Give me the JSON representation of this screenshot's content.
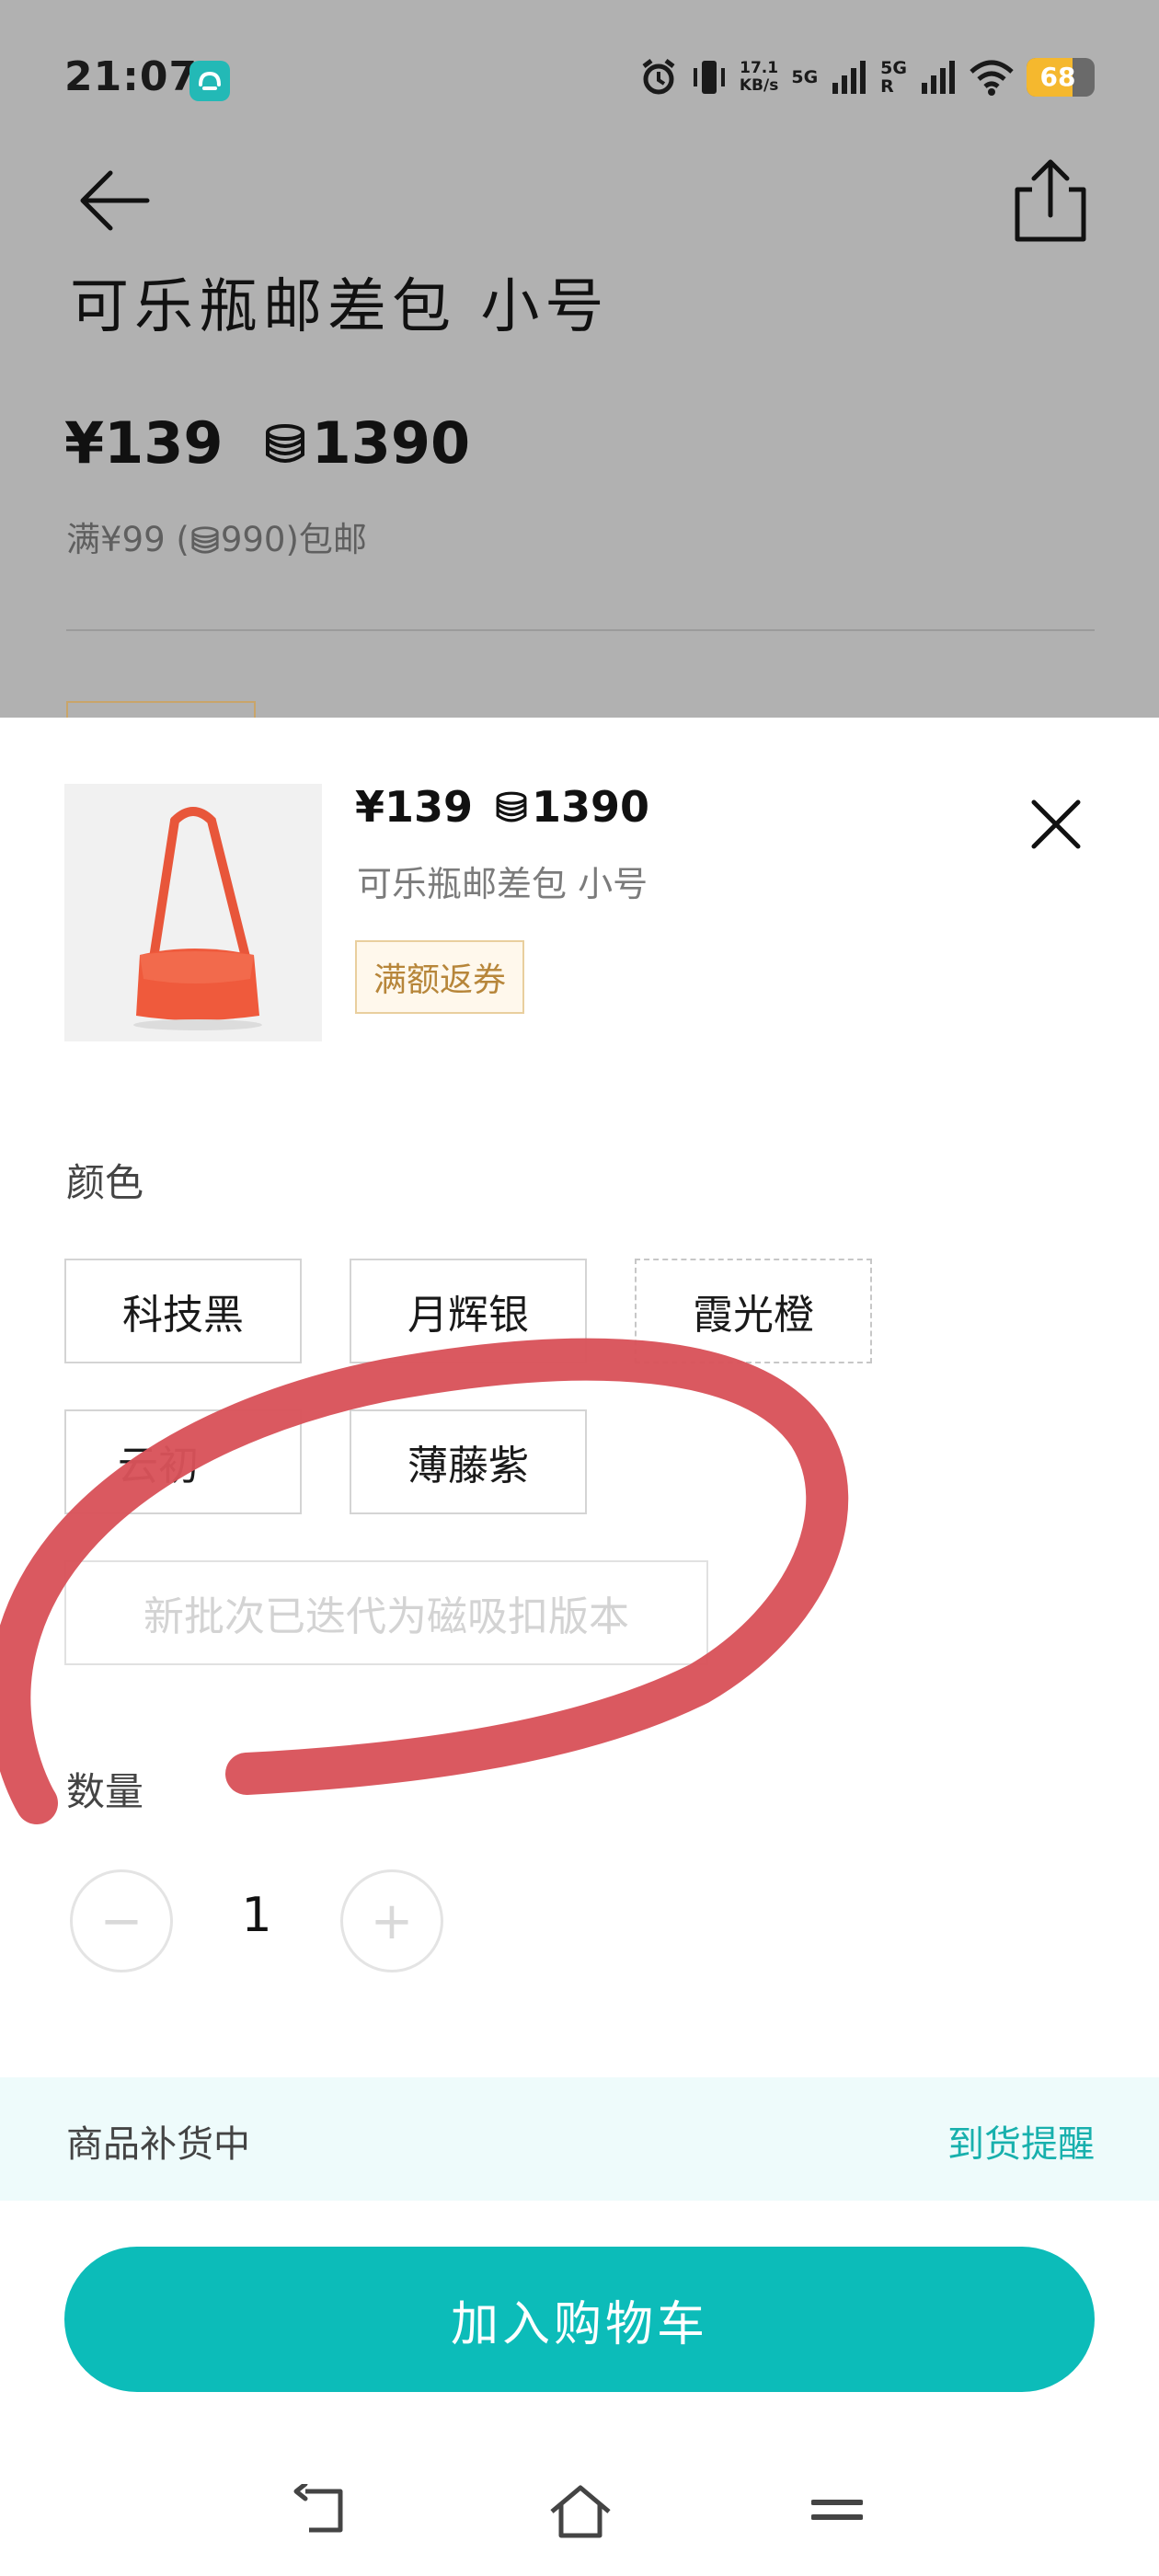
{
  "status_bar": {
    "time": "21:07",
    "speed_value": "17.1",
    "speed_unit": "KB/s",
    "net1": "5G",
    "net2": "5G",
    "net2_sub": "R",
    "battery": "68",
    "battery_level_percent": 68
  },
  "background_page": {
    "title": "可乐瓶邮差包 小号",
    "price": "¥139",
    "points": "1390",
    "shipping_note": "满¥99 (",
    "shipping_points": "990)包邮"
  },
  "sheet": {
    "price": "¥139",
    "points": "1390",
    "product_name": "可乐瓶邮差包 小号",
    "promo_tag": "满额返券",
    "color_label": "颜色",
    "colors": [
      {
        "label": "科技黑",
        "state": "normal"
      },
      {
        "label": "月辉银",
        "state": "normal"
      },
      {
        "label": "霞光橙",
        "state": "selected"
      },
      {
        "label": "云初",
        "state": "normal"
      },
      {
        "label": "薄藤紫",
        "state": "normal"
      },
      {
        "label": "新批次已迭代为磁吸扣版本",
        "state": "disabled"
      }
    ],
    "quantity_label": "数量",
    "quantity": "1",
    "minus": "−",
    "plus": "+",
    "restock_text": "商品补货中",
    "restock_link": "到货提醒",
    "add_to_cart": "加入购物车"
  },
  "colors": {
    "accent": "#0cbcb9",
    "accent_text": "#18b0ad",
    "tag_text": "#b7863a",
    "tag_border": "#e9cf9e",
    "markup_stroke": "#d9525a",
    "product_bag": "#ef5a3c"
  },
  "icons": {
    "back": "arrow-left-icon",
    "share": "share-icon",
    "close": "close-icon",
    "coin": "coin-stack-icon",
    "nav_back": "nav-back-icon",
    "nav_home": "nav-home-icon",
    "nav_menu": "nav-menu-icon"
  }
}
